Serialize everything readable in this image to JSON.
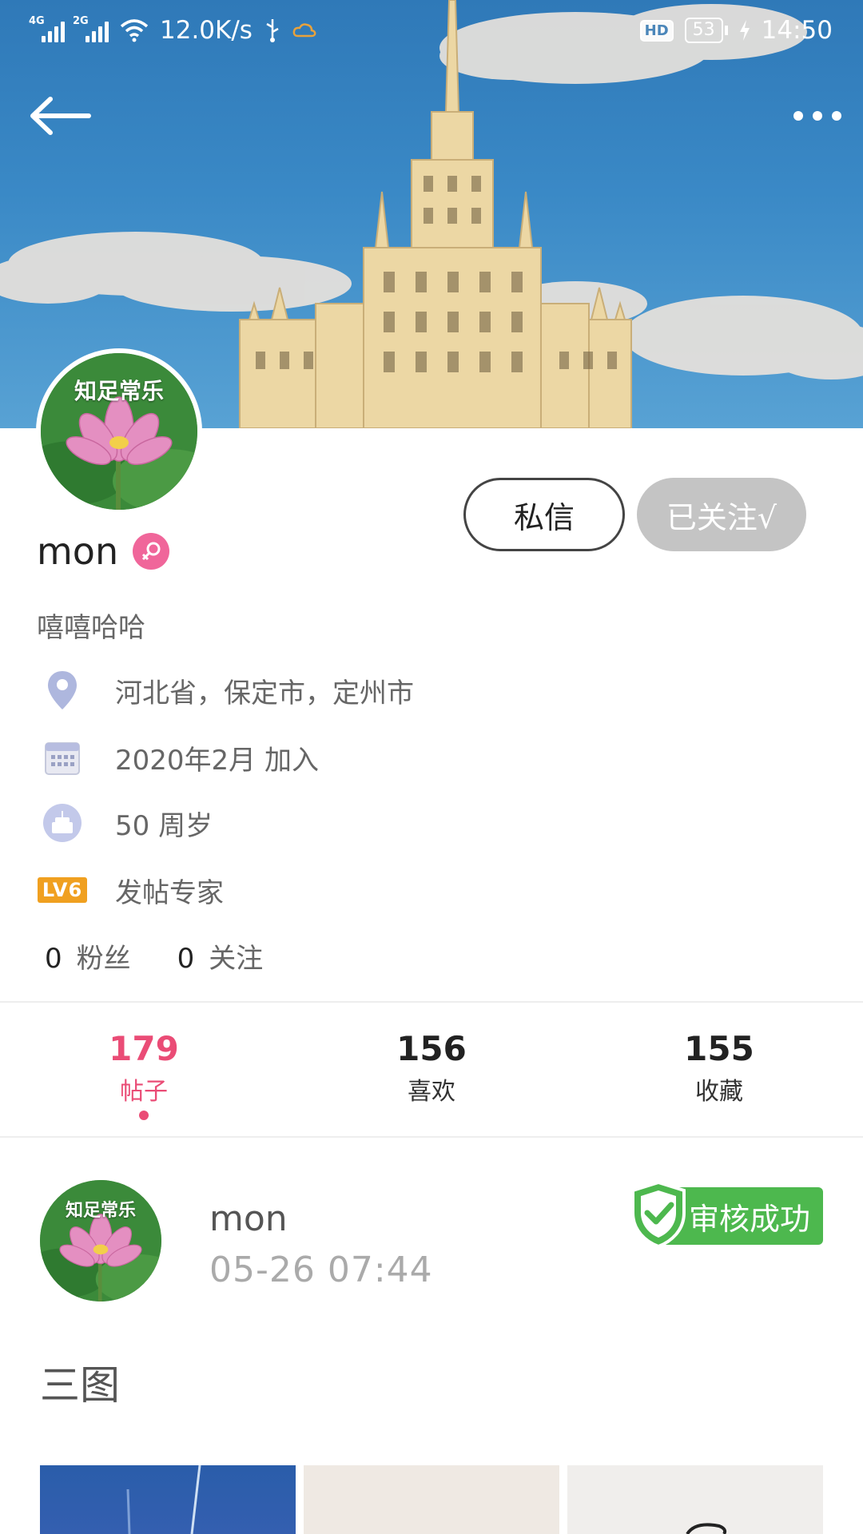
{
  "status_bar": {
    "signal1_tag": "4G",
    "signal2_tag": "2G",
    "network_speed": "12.0K/s",
    "hd": "HD",
    "battery": "53",
    "time": "14:50"
  },
  "header": {
    "back_icon": "arrow-left-icon",
    "more_icon": "more-dots-icon"
  },
  "profile": {
    "avatar_caption": "知足常乐",
    "username": "mon",
    "gender": "female",
    "bio": "嘻嘻哈哈",
    "location": "河北省，保定市，定州市",
    "joined": "2020年2月 加入",
    "age": "50 周岁",
    "level_badge": "LV6",
    "level_title": "发帖专家",
    "fans_count": "0",
    "fans_label": "粉丝",
    "following_count": "0",
    "following_label": "关注"
  },
  "actions": {
    "message": "私信",
    "followed": "已关注√"
  },
  "tabs": [
    {
      "count": "179",
      "label": "帖子",
      "active": true
    },
    {
      "count": "156",
      "label": "喜欢",
      "active": false
    },
    {
      "count": "155",
      "label": "收藏",
      "active": false
    }
  ],
  "post": {
    "avatar_caption": "知足常乐",
    "author": "mon",
    "time": "05-26 07:44",
    "status": "审核成功",
    "title": "三图"
  },
  "colors": {
    "accent": "#ea4c76",
    "gender_badge": "#f0669a",
    "followed_bg": "#c4c4c4",
    "review_green": "#4db84e",
    "level_orange": "#f0a020"
  }
}
